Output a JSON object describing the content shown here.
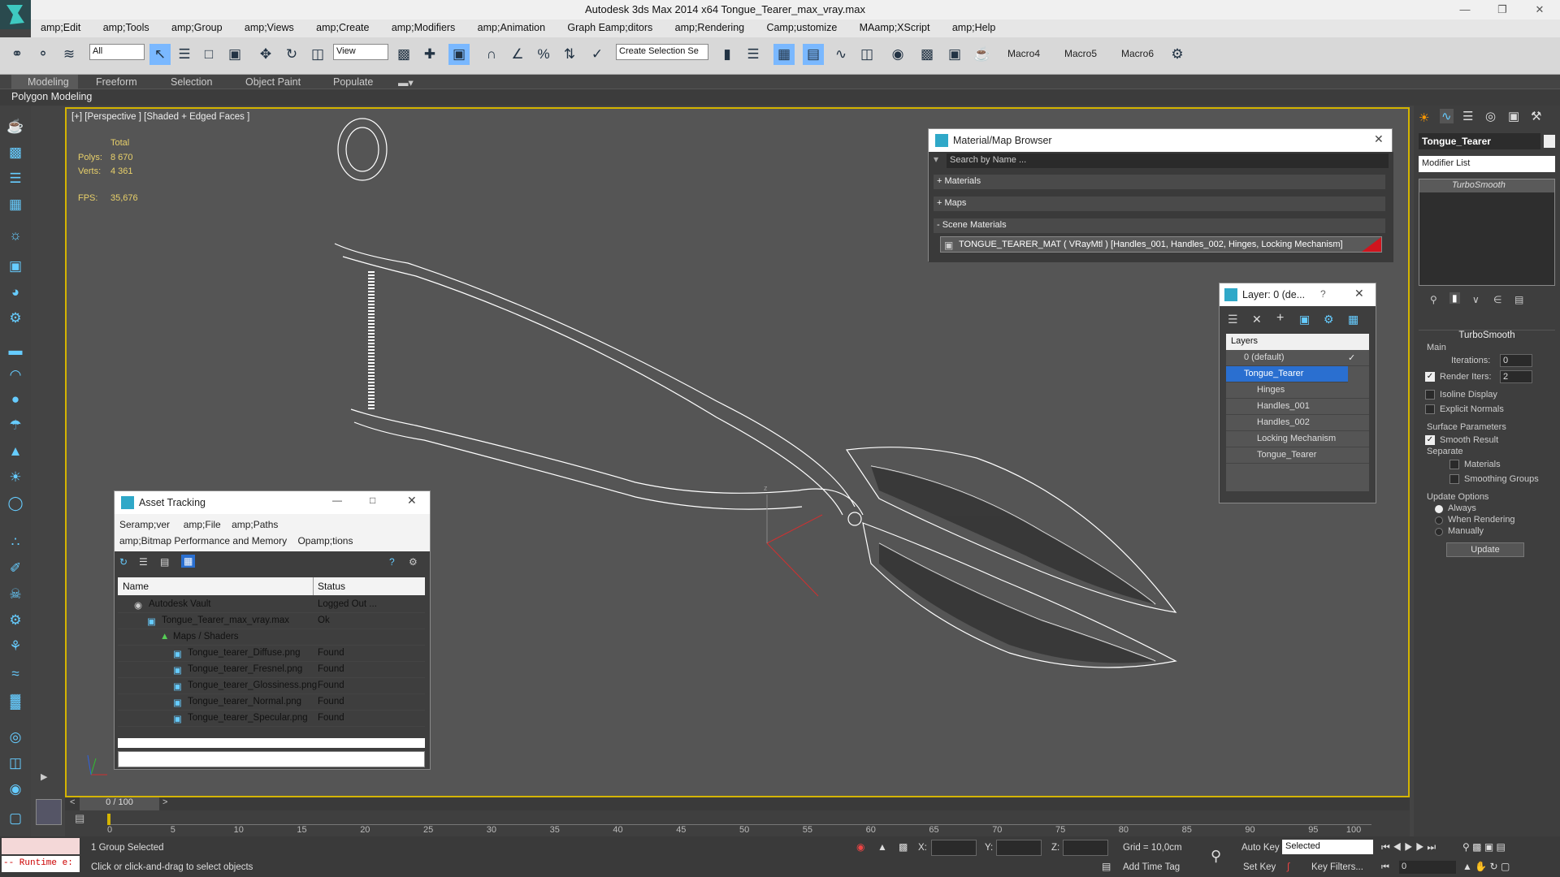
{
  "window": {
    "title": "Autodesk 3ds Max  2014 x64     Tongue_Tearer_max_vray.max"
  },
  "menu": [
    "amp;Edit",
    "amp;Tools",
    "amp;Group",
    "amp;Views",
    "amp;Create",
    "amp;Modifiers",
    "amp;Animation",
    "Graph Eamp;ditors",
    "amp;Rendering",
    "Camp;ustomize",
    "MAamp;XScript",
    "amp;Help"
  ],
  "toolbar": {
    "filter_value": "All",
    "view_value": "View",
    "selection_set_placeholder": "Create Selection Se",
    "macros": [
      "Macro4",
      "Macro5",
      "Macro6"
    ]
  },
  "ribbon": {
    "tabs": [
      "Modeling",
      "Freeform",
      "Selection",
      "Object Paint",
      "Populate"
    ],
    "sub": "Polygon Modeling"
  },
  "viewport": {
    "label": "[+] [Perspective ] [Shaded + Edged Faces ]",
    "total_label": "Total",
    "polys_label": "Polys:",
    "polys": "8 670",
    "verts_label": "Verts:",
    "verts": "4 361",
    "fps_label": "FPS:",
    "fps": "35,676",
    "axis_z": "z"
  },
  "material_browser": {
    "title": "Material/Map Browser",
    "search_placeholder": "Search by Name ...",
    "sections": [
      "+ Materials",
      "+ Maps",
      "- Scene Materials"
    ],
    "material": "TONGUE_TEARER_MAT  ( VRayMtl )  [Handles_001, Handles_002, Hinges, Locking Mechanism]",
    "accent": "#d0141e"
  },
  "layer_dialog": {
    "title": "Layer: 0 (de...",
    "help": "?",
    "header": "Layers",
    "items": [
      "0 (default)",
      "Tongue_Tearer",
      "Hinges",
      "Handles_001",
      "Handles_002",
      "Locking Mechanism",
      "Tongue_Tearer"
    ]
  },
  "asset_tracking": {
    "title": "Asset Tracking",
    "menu": [
      "Seramp;ver",
      "amp;File",
      "amp;Paths",
      "amp;Bitmap Performance and Memory",
      "Opamp;tions"
    ],
    "columns": [
      "Name",
      "Status"
    ],
    "rows": [
      {
        "name": "Autodesk Vault",
        "status": "Logged Out ..."
      },
      {
        "name": "Tongue_Tearer_max_vray.max",
        "status": "Ok"
      },
      {
        "name": "Maps / Shaders",
        "status": ""
      },
      {
        "name": "Tongue_tearer_Diffuse.png",
        "status": "Found"
      },
      {
        "name": "Tongue_tearer_Fresnel.png",
        "status": "Found"
      },
      {
        "name": "Tongue_tearer_Glossiness.png",
        "status": "Found"
      },
      {
        "name": "Tongue_tearer_Normal.png",
        "status": "Found"
      },
      {
        "name": "Tongue_tearer_Specular.png",
        "status": "Found"
      }
    ]
  },
  "command_panel": {
    "object_name": "Tongue_Tearer",
    "modifier_list": "Modifier List",
    "stack_item": "TurboSmooth",
    "rollout_title": "TurboSmooth",
    "main_label": "Main",
    "iterations_label": "Iterations:",
    "iterations": "0",
    "render_iters_label": "Render Iters:",
    "render_iters": "2",
    "isoline": "Isoline Display",
    "explicit_normals": "Explicit Normals",
    "surface_params": "Surface Parameters",
    "smooth_result": "Smooth Result",
    "separate": "Separate",
    "materials": "Materials",
    "smoothing_groups": "Smoothing Groups",
    "update_options": "Update Options",
    "always": "Always",
    "when_rendering": "When Rendering",
    "manually": "Manually",
    "update_button": "Update"
  },
  "timeline": {
    "frame": "0 / 100",
    "ticks": [
      "0",
      "5",
      "10",
      "15",
      "20",
      "25",
      "30",
      "35",
      "40",
      "45",
      "50",
      "55",
      "60",
      "65",
      "70",
      "75",
      "80",
      "85",
      "90",
      "95",
      "100"
    ]
  },
  "status": {
    "runtime": "-- Runtime e:",
    "selected": "1 Group Selected",
    "prompt": "Click or click-and-drag to select objects",
    "x_label": "X:",
    "y_label": "Y:",
    "z_label": "Z:",
    "grid": "Grid = 10,0cm",
    "add_time_tag": "Add Time Tag",
    "auto_key": "Auto Key",
    "set_key": "Set Key",
    "selected_dd": "Selected",
    "key_filters": "Key Filters...",
    "frame_value": "0"
  }
}
